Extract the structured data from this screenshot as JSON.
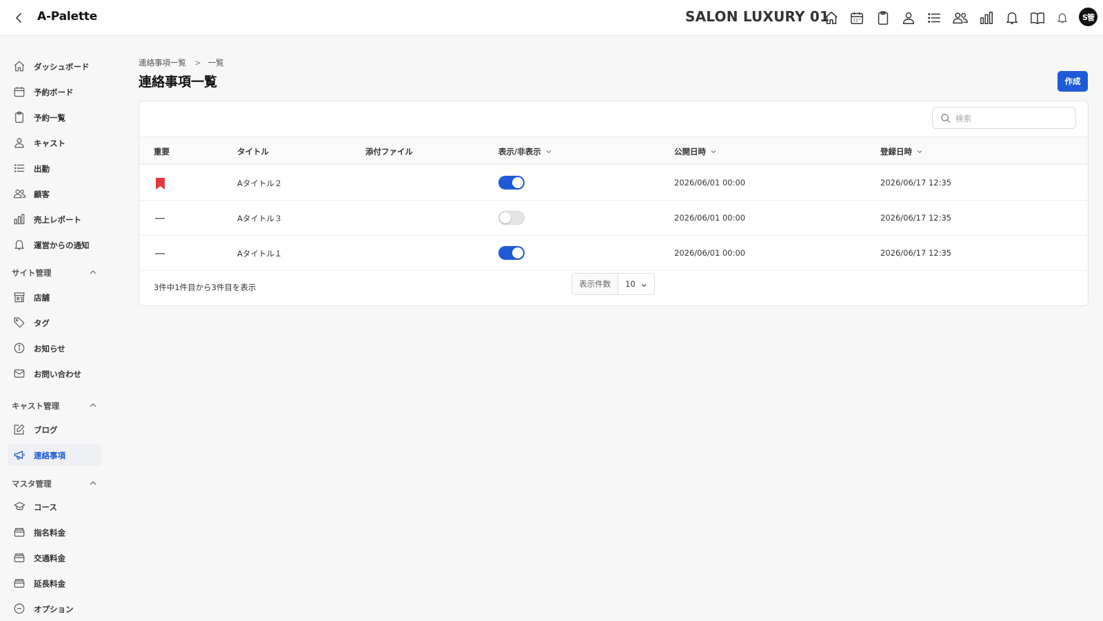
{
  "header": {
    "app_title": "A-Palette",
    "salon_name": "SALON LUXURY 01",
    "avatar_text": "S管",
    "icons": [
      "home-icon",
      "calendar-icon",
      "clipboard-icon",
      "user-icon",
      "list-icon",
      "users-icon",
      "bar-chart-icon",
      "bell-icon",
      "book-icon",
      "bell-small-icon"
    ]
  },
  "sidebar": {
    "items": [
      {
        "label": "ダッシュボード",
        "icon": "home-icon"
      },
      {
        "label": "予約ボード",
        "icon": "calendar-icon"
      },
      {
        "label": "予約一覧",
        "icon": "clipboard-icon"
      },
      {
        "label": "キャスト",
        "icon": "user-icon"
      },
      {
        "label": "出勤",
        "icon": "list-icon"
      },
      {
        "label": "顧客",
        "icon": "users-icon"
      },
      {
        "label": "売上レポート",
        "icon": "bar-chart-icon"
      },
      {
        "label": "運営からの通知",
        "icon": "bell-icon"
      }
    ],
    "site_section": {
      "label": "サイト管理",
      "items": [
        {
          "label": "店舗",
          "icon": "store-icon"
        },
        {
          "label": "タグ",
          "icon": "tag-icon"
        },
        {
          "label": "お知らせ",
          "icon": "info-icon"
        },
        {
          "label": "お問い合わせ",
          "icon": "mail-icon"
        }
      ]
    },
    "cast_section": {
      "label": "キャスト管理",
      "items": [
        {
          "label": "ブログ",
          "icon": "edit-icon"
        },
        {
          "label": "連絡事項",
          "icon": "megaphone-icon",
          "active": true
        }
      ]
    },
    "master_section": {
      "label": "マスタ管理",
      "items": [
        {
          "label": "コース",
          "icon": "graduation-cap-icon"
        },
        {
          "label": "指名料金",
          "icon": "wallet-icon"
        },
        {
          "label": "交通料金",
          "icon": "wallet-icon"
        },
        {
          "label": "延長料金",
          "icon": "wallet-icon"
        },
        {
          "label": "オプション",
          "icon": "option-icon"
        }
      ]
    }
  },
  "breadcrumb": {
    "parent": "連絡事項一覧",
    "separator": ">",
    "current": "一覧"
  },
  "page": {
    "title": "連絡事項一覧",
    "create_label": "作成"
  },
  "search": {
    "placeholder": "検索",
    "value": ""
  },
  "table": {
    "columns": {
      "important": "重要",
      "title": "タイトル",
      "attachment": "添付ファイル",
      "visibility": "表示/非表示",
      "published": "公開日時",
      "registered": "登録日時"
    },
    "rows": [
      {
        "important": true,
        "title": "Aタイトル２",
        "attachment": "",
        "visible": true,
        "published": "2026/06/01 00:00",
        "registered": "2026/06/17 12:35"
      },
      {
        "important": false,
        "title": "Aタイトル３",
        "attachment": "",
        "visible": false,
        "published": "2026/06/01 00:00",
        "registered": "2026/06/17 12:35"
      },
      {
        "important": false,
        "title": "Aタイトル１",
        "attachment": "",
        "visible": true,
        "published": "2026/06/01 00:00",
        "registered": "2026/06/17 12:35"
      }
    ],
    "footer_info": "3件中1件目から3件目を表示",
    "per_page_label": "表示件数",
    "per_page_value": "10"
  },
  "colors": {
    "accent": "#1f5bd6",
    "important_flag": "#e5383b"
  }
}
